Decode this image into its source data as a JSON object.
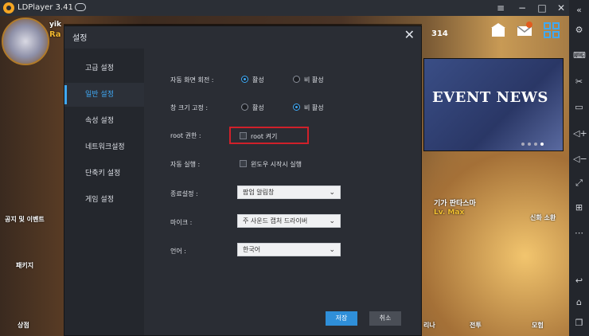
{
  "window": {
    "title": "LDPlayer 3.41"
  },
  "game": {
    "gem_count": "314",
    "event_banner": "EVENT NEWS",
    "hero_name": "기가 판타스마",
    "hero_level": "Lv. Max",
    "summon_label": "신화 소환",
    "left_labels": [
      "공지 및 이벤트",
      "패키지",
      "상점"
    ],
    "bottom_labels": [
      "리나",
      "전투",
      "모험"
    ],
    "name_partial": "Ra",
    "name_partial2": "yik"
  },
  "dialog": {
    "title": "설정",
    "nav": [
      "고급 설정",
      "일반 설정",
      "속성 설정",
      "네트워크설정",
      "단축키 설정",
      "게임 설정"
    ],
    "active_nav": "일반 설정",
    "rows": {
      "auto_rotate": {
        "label": "자동 화면 회전 :",
        "opt_on": "활성",
        "opt_off": "비 활성",
        "selected": "활성"
      },
      "fix_window": {
        "label": "창 크기 고정 :",
        "opt_on": "활성",
        "opt_off": "비 활성",
        "selected": "비 활성"
      },
      "root": {
        "label": "root 권한 :",
        "checkbox": "root 켜기",
        "checked": false
      },
      "autostart": {
        "label": "자동 실행 :",
        "checkbox": "윈도우 시작시 실행",
        "checked": false
      },
      "exit": {
        "label": "종료설정 :",
        "value": "팝업 알림창"
      },
      "mic": {
        "label": "마이크 :",
        "value": "주 사운드 캡처 드라이버"
      },
      "language": {
        "label": "언어 :",
        "value": "한국어"
      }
    },
    "save_label": "저장",
    "cancel_label": "취소"
  },
  "colors": {
    "accent": "#3fa9f5",
    "highlight_box": "#d0202a",
    "save_button": "#2f8fd9"
  }
}
